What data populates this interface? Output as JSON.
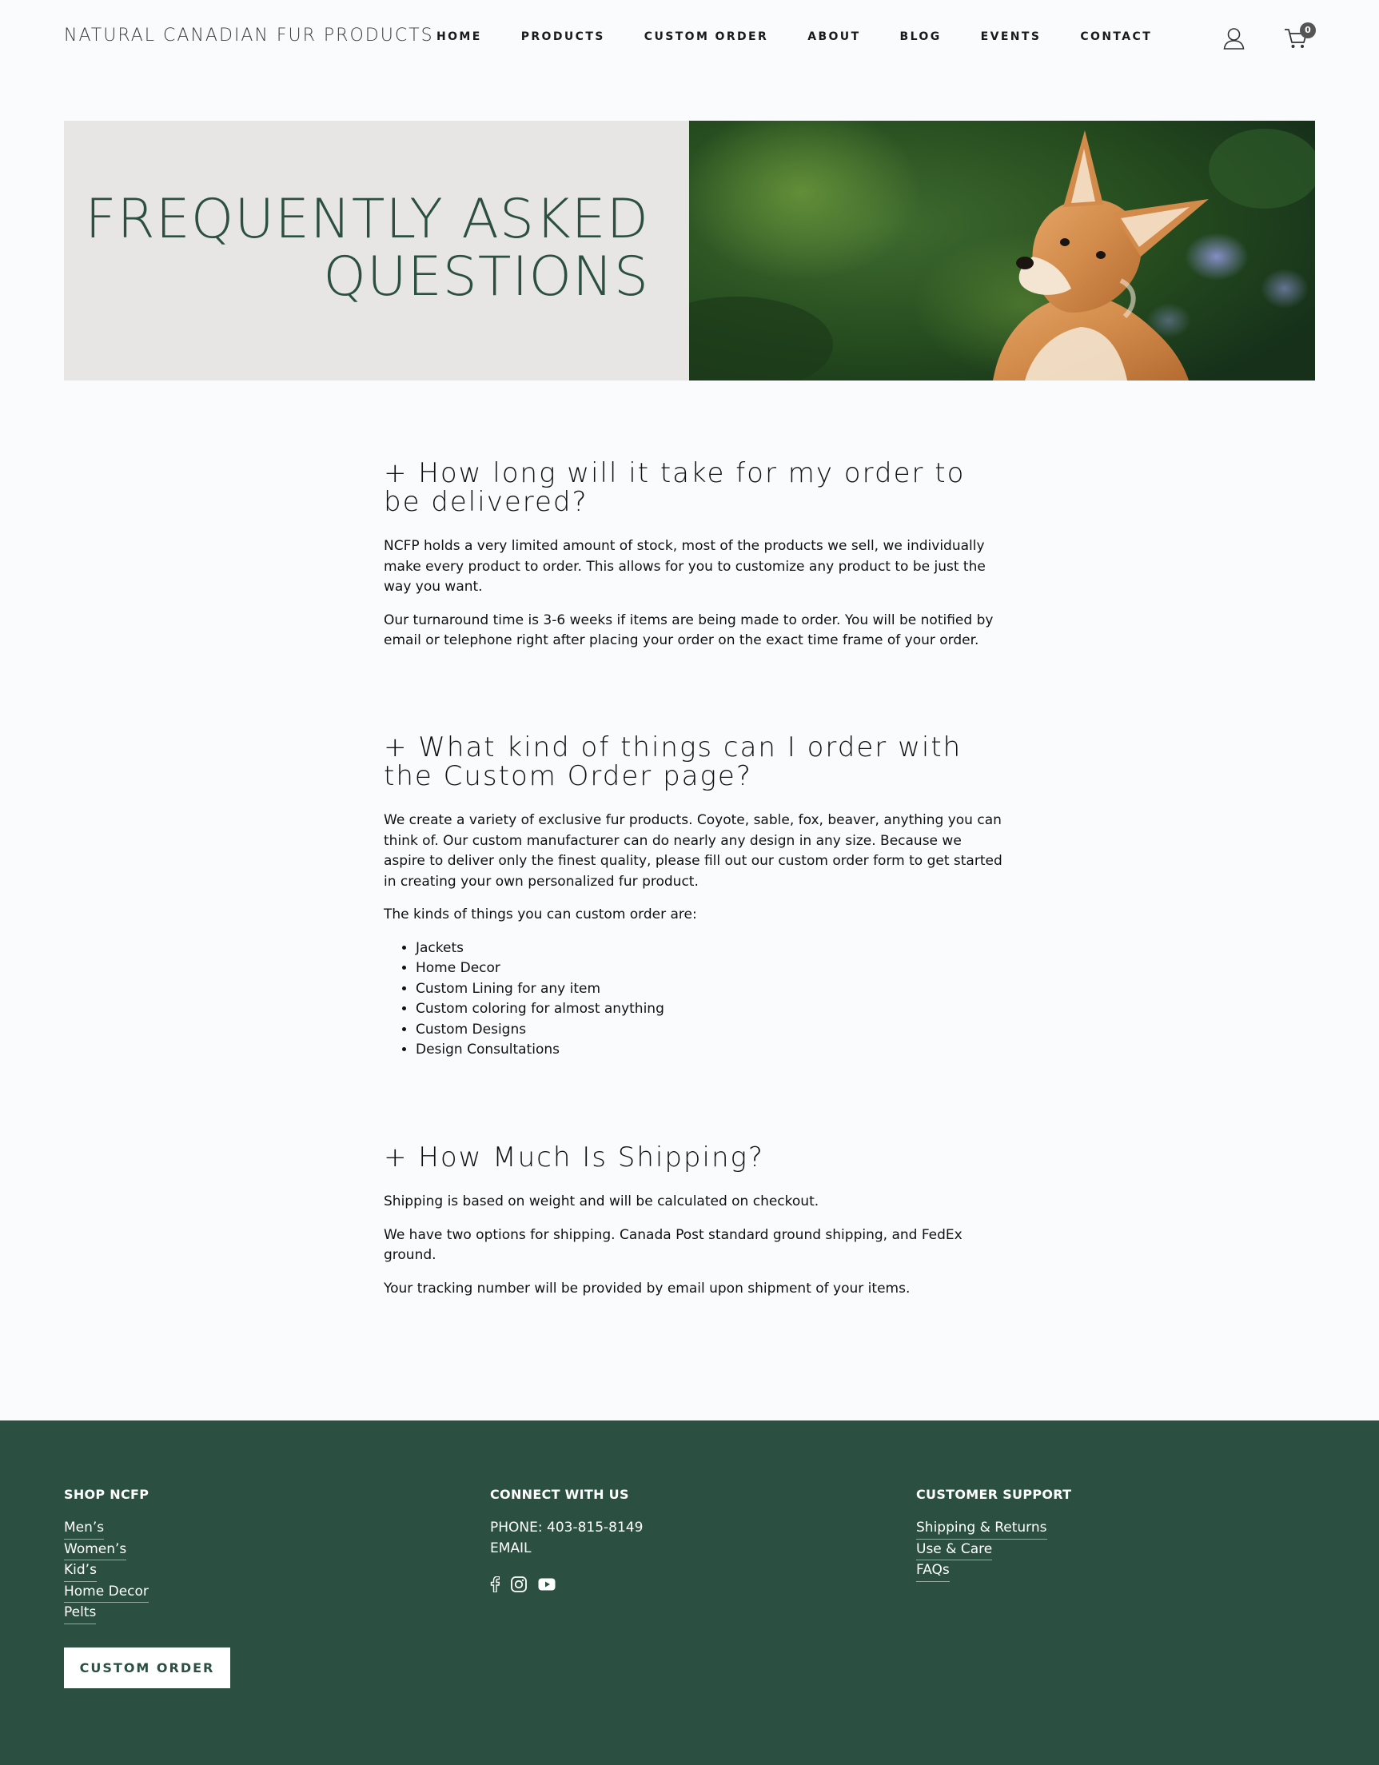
{
  "header": {
    "logo": "NATURAL CANADIAN FUR PRODUCTS",
    "nav": [
      "HOME",
      "PRODUCTS",
      "CUSTOM ORDER",
      "ABOUT",
      "BLOG",
      "EVENTS",
      "CONTACT"
    ],
    "user_icon": "user-icon",
    "cart_icon": "cart-icon",
    "cart_count": "0"
  },
  "hero": {
    "title_line1": "FREQUENTLY ASKED",
    "title_line2": "QUESTIONS",
    "image": "fox-photo"
  },
  "faq": [
    {
      "question": "+ How long will it take for my order to be delivered?",
      "paragraphs": [
        "NCFP holds a very limited amount of stock, most of the products we sell, we individually make every product to order. This allows for you to customize any product to be just the way you want.",
        "Our turnaround time is 3-6 weeks if items are being made to order. You will be notified by email or telephone right after placing your order on the exact time frame of your order."
      ]
    },
    {
      "question": "+ What kind of things can I order with the Custom Order page?",
      "paragraphs": [
        "We create a variety of exclusive fur products. Coyote, sable, fox, beaver, anything you can think of. Our custom manufacturer can do nearly any design in any size. Because we aspire to deliver only the finest quality, please fill out our custom order form to get started in creating your own personalized fur product.",
        "The kinds of things you can custom order are:"
      ],
      "list": [
        "Jackets",
        "Home Decor",
        "Custom Lining for any item",
        "Custom coloring for almost anything",
        "Custom Designs",
        "Design Consultations"
      ]
    },
    {
      "question": "+ How Much Is Shipping?",
      "paragraphs": [
        "Shipping is based on weight and will be calculated on checkout.",
        "We have two options for shipping. Canada Post standard ground shipping, and FedEx ground.",
        "Your tracking number will be provided by email upon shipment of your items."
      ]
    }
  ],
  "footer": {
    "shop": {
      "heading": "SHOP NCFP",
      "links": [
        "Men’s",
        "Women’s",
        "Kid’s",
        "Home Decor",
        "Pelts"
      ],
      "button": "CUSTOM ORDER"
    },
    "connect": {
      "heading": "CONNECT WITH US",
      "phone": "PHONE: 403-815-8149",
      "email": "EMAIL",
      "social_icons": [
        "facebook-icon",
        "instagram-icon",
        "youtube-icon"
      ]
    },
    "support": {
      "heading": "CUSTOMER SUPPORT",
      "links": [
        "Shipping & Returns",
        "Use & Care",
        "FAQs"
      ]
    }
  },
  "colors": {
    "brand_green": "#2b5042",
    "hero_panel": "#e8e6e4",
    "background": "#fafbfd"
  }
}
